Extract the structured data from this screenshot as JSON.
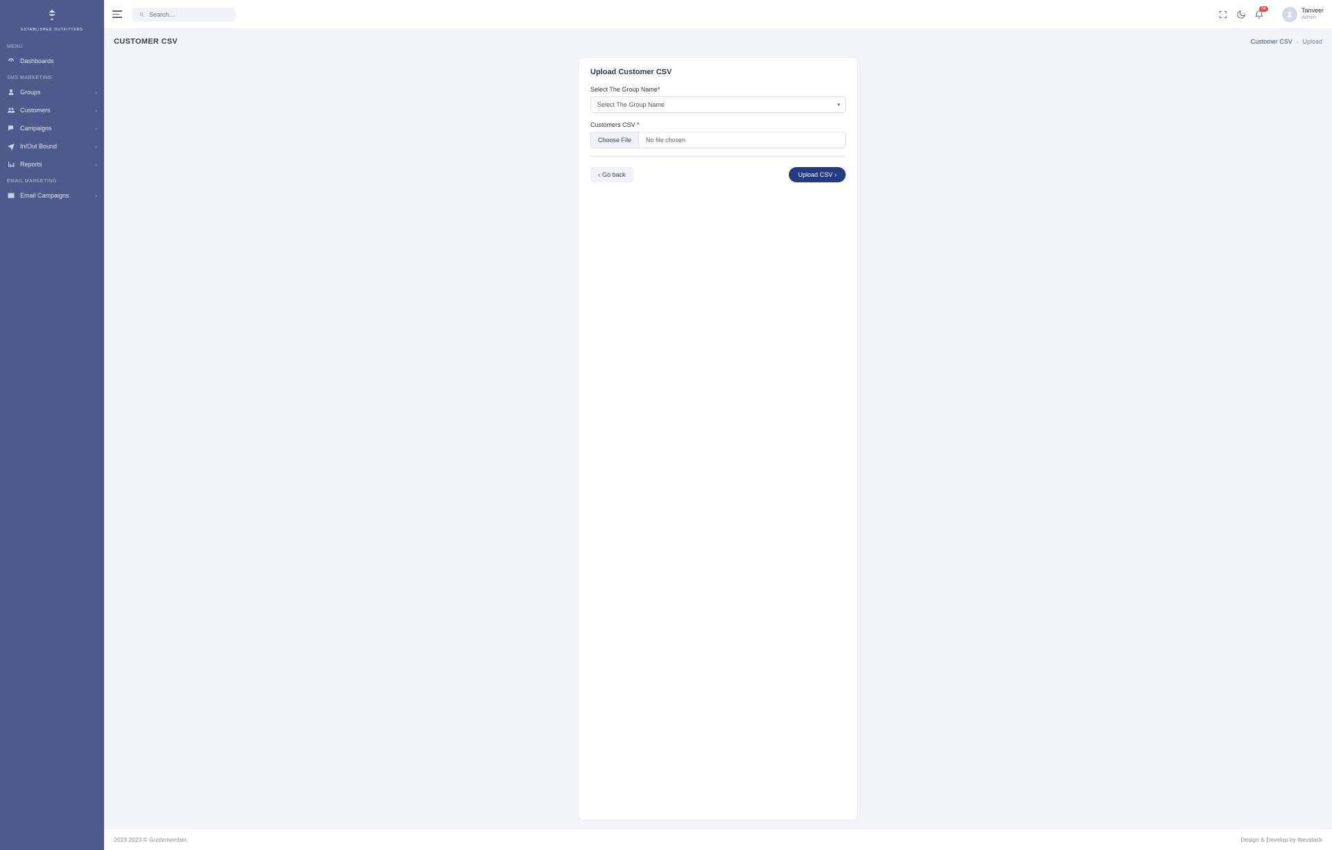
{
  "brand": {
    "left": "ESTABLISHED",
    "right": "OUTFITTERS"
  },
  "sidebar": {
    "sections": [
      {
        "title": "MENU",
        "items": [
          {
            "icon": "gauge",
            "label": "Dashboards",
            "has_children": false
          }
        ]
      },
      {
        "title": "SMS MARKETING",
        "items": [
          {
            "icon": "user",
            "label": "Groups",
            "has_children": true
          },
          {
            "icon": "users",
            "label": "Customers",
            "has_children": true
          },
          {
            "icon": "comments",
            "label": "Campaigns",
            "has_children": true
          },
          {
            "icon": "plane",
            "label": "In/Out Bound",
            "has_children": true
          },
          {
            "icon": "chart",
            "label": "Reports",
            "has_children": true
          }
        ]
      },
      {
        "title": "EMAIL MARKETING",
        "items": [
          {
            "icon": "envelope",
            "label": "Email Campaigns",
            "has_children": true
          }
        ]
      }
    ]
  },
  "topbar": {
    "search_placeholder": "Search...",
    "badge_count": "04",
    "user": {
      "name": "Tanveer",
      "role": "Admin"
    }
  },
  "page": {
    "title": "CUSTOMER CSV",
    "breadcrumb": {
      "parent": "Customer CSV",
      "current": "Upload"
    },
    "card": {
      "title": "Upload Customer CSV",
      "group_label": "Select The Group Name*",
      "group_placeholder": "Select The Group Name",
      "csv_label": "Customers CSV *",
      "choose_file": "Choose File",
      "no_file": "No file chosen",
      "back": "Go back",
      "submit": "Upload CSV"
    }
  },
  "footer": {
    "left": "2023 2023 © Guidemember.",
    "right": "Design & Develop by Ibexstack"
  }
}
